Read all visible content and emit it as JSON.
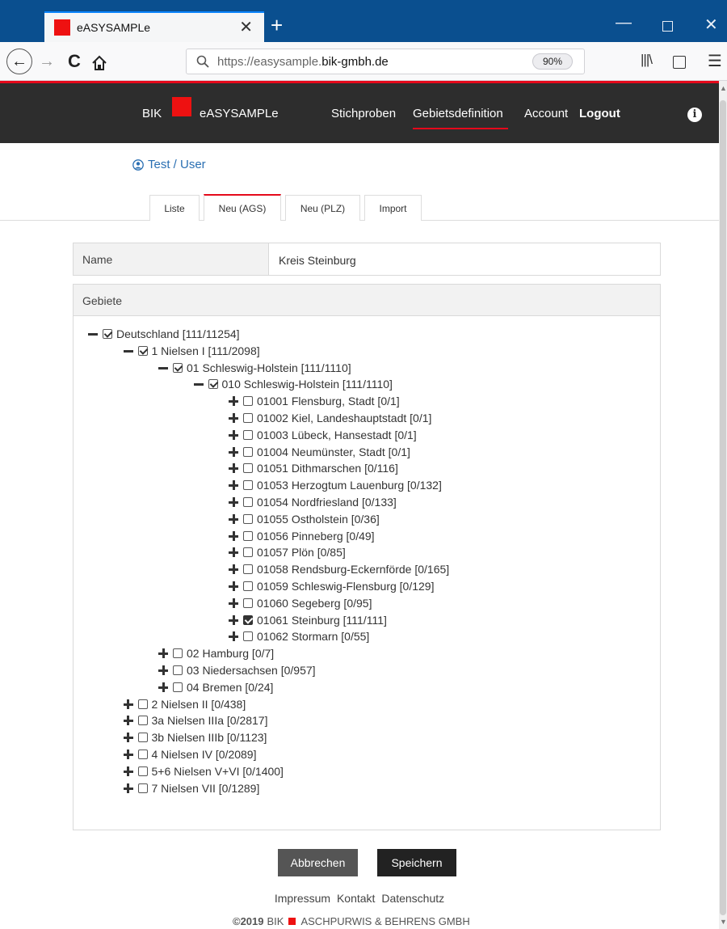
{
  "browser": {
    "tab_title": "eASYSAMPLe",
    "tab_close": "✕",
    "new_tab": "+",
    "url_host_prefix": "https://easysample.",
    "url_host_domain": "bik-gmbh.de",
    "zoom": "90%"
  },
  "colors": {
    "brand_red": "#ee1111",
    "accent_red": "#e5091b",
    "appbar": "#2d2d2d",
    "link_blue": "#2a6fb2"
  },
  "header": {
    "brand_left": "BIK",
    "brand_name": "eASYSAMPLe",
    "nav": [
      "Stichproben",
      "Gebietsdefinition",
      "Account",
      "Logout"
    ]
  },
  "user": {
    "label": "Test / User"
  },
  "tabs": [
    "Liste",
    "Neu (AGS)",
    "Neu (PLZ)",
    "Import"
  ],
  "active_tab": "Neu (AGS)",
  "form": {
    "name_label": "Name",
    "name_value": "Kreis Steinburg",
    "gebiete_label": "Gebiete"
  },
  "tree": [
    {
      "label": "Deutschland [111/11254]",
      "level": 0,
      "expanded": true,
      "check": "partial"
    },
    {
      "label": "1 Nielsen I [111/2098]",
      "level": 1,
      "expanded": true,
      "check": "partial"
    },
    {
      "label": "01 Schleswig-Holstein [111/1110]",
      "level": 2,
      "expanded": true,
      "check": "partial"
    },
    {
      "label": "010 Schleswig-Holstein [111/1110]",
      "level": 3,
      "expanded": true,
      "check": "partial"
    },
    {
      "label": "01001 Flensburg, Stadt [0/1]",
      "level": 4,
      "expanded": false,
      "check": "none"
    },
    {
      "label": "01002 Kiel, Landeshauptstadt [0/1]",
      "level": 4,
      "expanded": false,
      "check": "none"
    },
    {
      "label": "01003 Lübeck, Hansestadt [0/1]",
      "level": 4,
      "expanded": false,
      "check": "none"
    },
    {
      "label": "01004 Neumünster, Stadt [0/1]",
      "level": 4,
      "expanded": false,
      "check": "none"
    },
    {
      "label": "01051 Dithmarschen [0/116]",
      "level": 4,
      "expanded": false,
      "check": "none"
    },
    {
      "label": "01053 Herzogtum Lauenburg [0/132]",
      "level": 4,
      "expanded": false,
      "check": "none"
    },
    {
      "label": "01054 Nordfriesland [0/133]",
      "level": 4,
      "expanded": false,
      "check": "none"
    },
    {
      "label": "01055 Ostholstein [0/36]",
      "level": 4,
      "expanded": false,
      "check": "none"
    },
    {
      "label": "01056 Pinneberg [0/49]",
      "level": 4,
      "expanded": false,
      "check": "none"
    },
    {
      "label": "01057 Plön [0/85]",
      "level": 4,
      "expanded": false,
      "check": "none"
    },
    {
      "label": "01058 Rendsburg-Eckernförde [0/165]",
      "level": 4,
      "expanded": false,
      "check": "none"
    },
    {
      "label": "01059 Schleswig-Flensburg [0/129]",
      "level": 4,
      "expanded": false,
      "check": "none"
    },
    {
      "label": "01060 Segeberg [0/95]",
      "level": 4,
      "expanded": false,
      "check": "none"
    },
    {
      "label": "01061 Steinburg [111/111]",
      "level": 4,
      "expanded": false,
      "check": "full"
    },
    {
      "label": "01062 Stormarn [0/55]",
      "level": 4,
      "expanded": false,
      "check": "none"
    },
    {
      "label": "02 Hamburg [0/7]",
      "level": 2,
      "expanded": false,
      "check": "none"
    },
    {
      "label": "03 Niedersachsen [0/957]",
      "level": 2,
      "expanded": false,
      "check": "none"
    },
    {
      "label": "04 Bremen [0/24]",
      "level": 2,
      "expanded": false,
      "check": "none"
    },
    {
      "label": "2 Nielsen II [0/438]",
      "level": 1,
      "expanded": false,
      "check": "none"
    },
    {
      "label": "3a Nielsen IIIa [0/2817]",
      "level": 1,
      "expanded": false,
      "check": "none"
    },
    {
      "label": "3b Nielsen IIIb [0/1123]",
      "level": 1,
      "expanded": false,
      "check": "none"
    },
    {
      "label": "4 Nielsen IV [0/2089]",
      "level": 1,
      "expanded": false,
      "check": "none"
    },
    {
      "label": "5+6 Nielsen V+VI [0/1400]",
      "level": 1,
      "expanded": false,
      "check": "none"
    },
    {
      "label": "7 Nielsen VII [0/1289]",
      "level": 1,
      "expanded": false,
      "check": "none"
    }
  ],
  "buttons": {
    "cancel": "Abbrechen",
    "save": "Speichern"
  },
  "footer": {
    "links": [
      "Impressum",
      "Kontakt",
      "Datenschutz"
    ],
    "copyright_year": "©2019",
    "copyright_left": "BIK",
    "copyright_right": "ASCHPURWIS & BEHRENS GMBH"
  }
}
